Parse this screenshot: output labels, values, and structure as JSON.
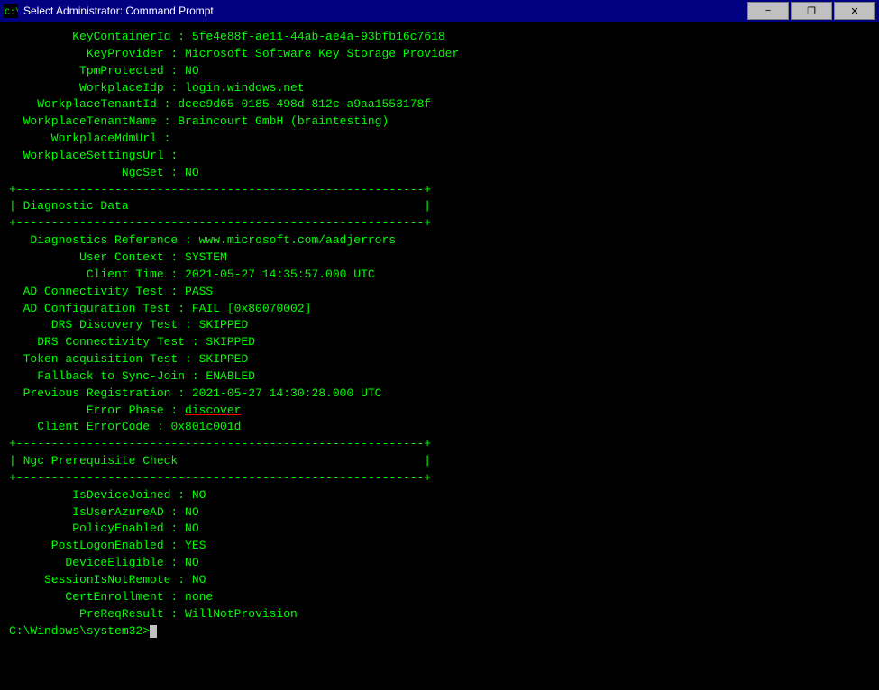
{
  "titleBar": {
    "icon": "C:\\",
    "prefix": "Select",
    "appName": "Administrator: Command Prompt",
    "minimizeLabel": "−",
    "restoreLabel": "❐",
    "closeLabel": "✕"
  },
  "console": {
    "lines": [
      "         KeyContainerId : 5fe4e88f-ae11-44ab-ae4a-93bfb16c7618",
      "           KeyProvider : Microsoft Software Key Storage Provider",
      "          TpmProtected : NO",
      "          WorkplaceIdp : login.windows.net",
      "    WorkplaceTenantId : dcec9d65-0185-498d-812c-a9aa1553178f",
      "  WorkplaceTenantName : Braincourt GmbH (braintesting)",
      "      WorkplaceMdmUrl :",
      "  WorkplaceSettingsUrl :",
      "                NgcSet : NO",
      "",
      "+----------------------------------------------------------+",
      "| Diagnostic Data                                          |",
      "+----------------------------------------------------------+",
      "",
      "   Diagnostics Reference : www.microsoft.com/aadjerrors",
      "          User Context : SYSTEM",
      "           Client Time : 2021-05-27 14:35:57.000 UTC",
      "  AD Connectivity Test : PASS",
      "  AD Configuration Test : FAIL [0x80070002]",
      "      DRS Discovery Test : SKIPPED",
      "    DRS Connectivity Test : SKIPPED",
      "  Token acquisition Test : SKIPPED",
      "    Fallback to Sync-Join : ENABLED",
      "",
      "  Previous Registration : 2021-05-27 14:30:28.000 UTC",
      "           Error Phase : discover",
      "    Client ErrorCode : 0x801c001d",
      "",
      "+----------------------------------------------------------+",
      "| Ngc Prerequisite Check                                   |",
      "+----------------------------------------------------------+",
      "",
      "         IsDeviceJoined : NO",
      "         IsUserAzureAD : NO",
      "         PolicyEnabled : NO",
      "      PostLogonEnabled : YES",
      "        DeviceEligible : NO",
      "     SessionIsNotRemote : NO",
      "        CertEnrollment : none",
      "          PreReqResult : WillNotProvision",
      "",
      "C:\\Windows\\system32>"
    ],
    "highlightLine": 25,
    "highlightLine2": 26
  }
}
